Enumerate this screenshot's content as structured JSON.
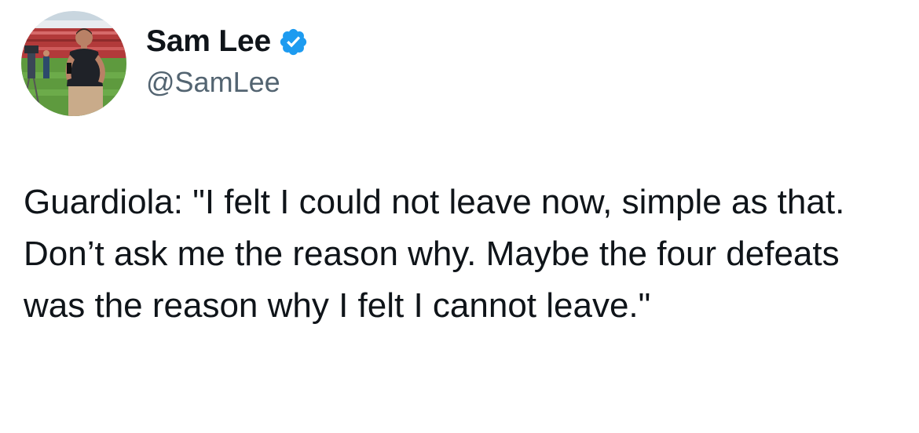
{
  "author": {
    "display_name": "Sam Lee",
    "handle": "@SamLee",
    "verified": true,
    "verified_badge_icon": "verified-badge-icon",
    "verified_color": "#1d9bf0"
  },
  "tweet": {
    "text": "Guardiola: \"I felt I could not leave now, simple as that. Don’t ask me the reason why. Maybe the four defeats was the reason why I felt I cannot leave.\""
  },
  "colors": {
    "text_primary": "#0f1419",
    "text_secondary": "#536471",
    "background": "#ffffff"
  }
}
